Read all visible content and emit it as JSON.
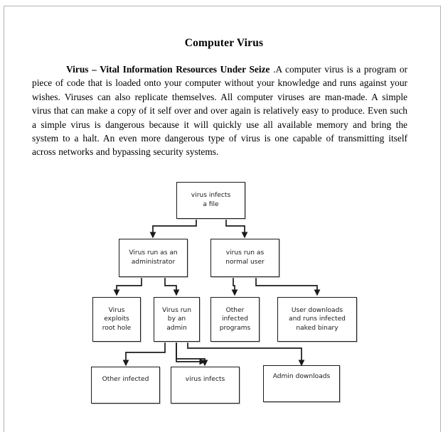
{
  "document": {
    "title": "Computer Virus",
    "paragraph_lead": "Virus – Vital Information Resources Under Seize",
    "paragraph_body": " .A computer virus is a program or piece of code that is loaded onto your computer without your knowledge and runs against your wishes. Viruses can also replicate themselves. All computer viruses are man-made. A simple virus that can make a copy of it self over and over again is relatively easy to produce. Even such a simple virus is dangerous because it will quickly use all available memory and bring the system to a halt. An even more dangerous type of virus is one capable of transmitting itself across networks and bypassing security systems."
  },
  "diagram": {
    "nodes": [
      {
        "id": "n1",
        "label": "virus infects\na file"
      },
      {
        "id": "n2",
        "label": "Virus run as an\nadministrator"
      },
      {
        "id": "n3",
        "label": "virus run as\nnormal user"
      },
      {
        "id": "n4",
        "label": "Virus\nexploits\nroot hole"
      },
      {
        "id": "n5",
        "label": "Virus run\nby an\nadmin"
      },
      {
        "id": "n6",
        "label": "Other\ninfected\nprograms"
      },
      {
        "id": "n7",
        "label": "User downloads\nand runs infected\nnaked binary"
      },
      {
        "id": "n8",
        "label": "Other infected"
      },
      {
        "id": "n9",
        "label": "virus infects"
      },
      {
        "id": "n10",
        "label": "Admin downloads"
      }
    ],
    "stroke_color": "#1a1a1a",
    "fill_color": "#ffffff"
  }
}
